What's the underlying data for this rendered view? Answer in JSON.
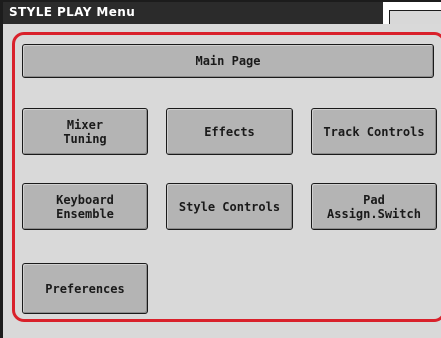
{
  "window": {
    "title": "STYLE PLAY Menu"
  },
  "menu": {
    "buttons": [
      {
        "id": "main-page",
        "label": "Main Page"
      },
      {
        "id": "mixer-tuning",
        "label": "Mixer\nTuning"
      },
      {
        "id": "effects",
        "label": "Effects"
      },
      {
        "id": "track-controls",
        "label": "Track Controls"
      },
      {
        "id": "keyboard-ensemble",
        "label": "Keyboard\nEnsemble"
      },
      {
        "id": "style-controls",
        "label": "Style Controls"
      },
      {
        "id": "pad-assign-switch",
        "label": "Pad\nAssign.Switch"
      },
      {
        "id": "preferences",
        "label": "Preferences"
      }
    ]
  },
  "colors": {
    "highlight": "#d9212b",
    "panel": "#d9d9d9",
    "button": "#b4b4b4",
    "title_bar": "#2b2b2b"
  }
}
